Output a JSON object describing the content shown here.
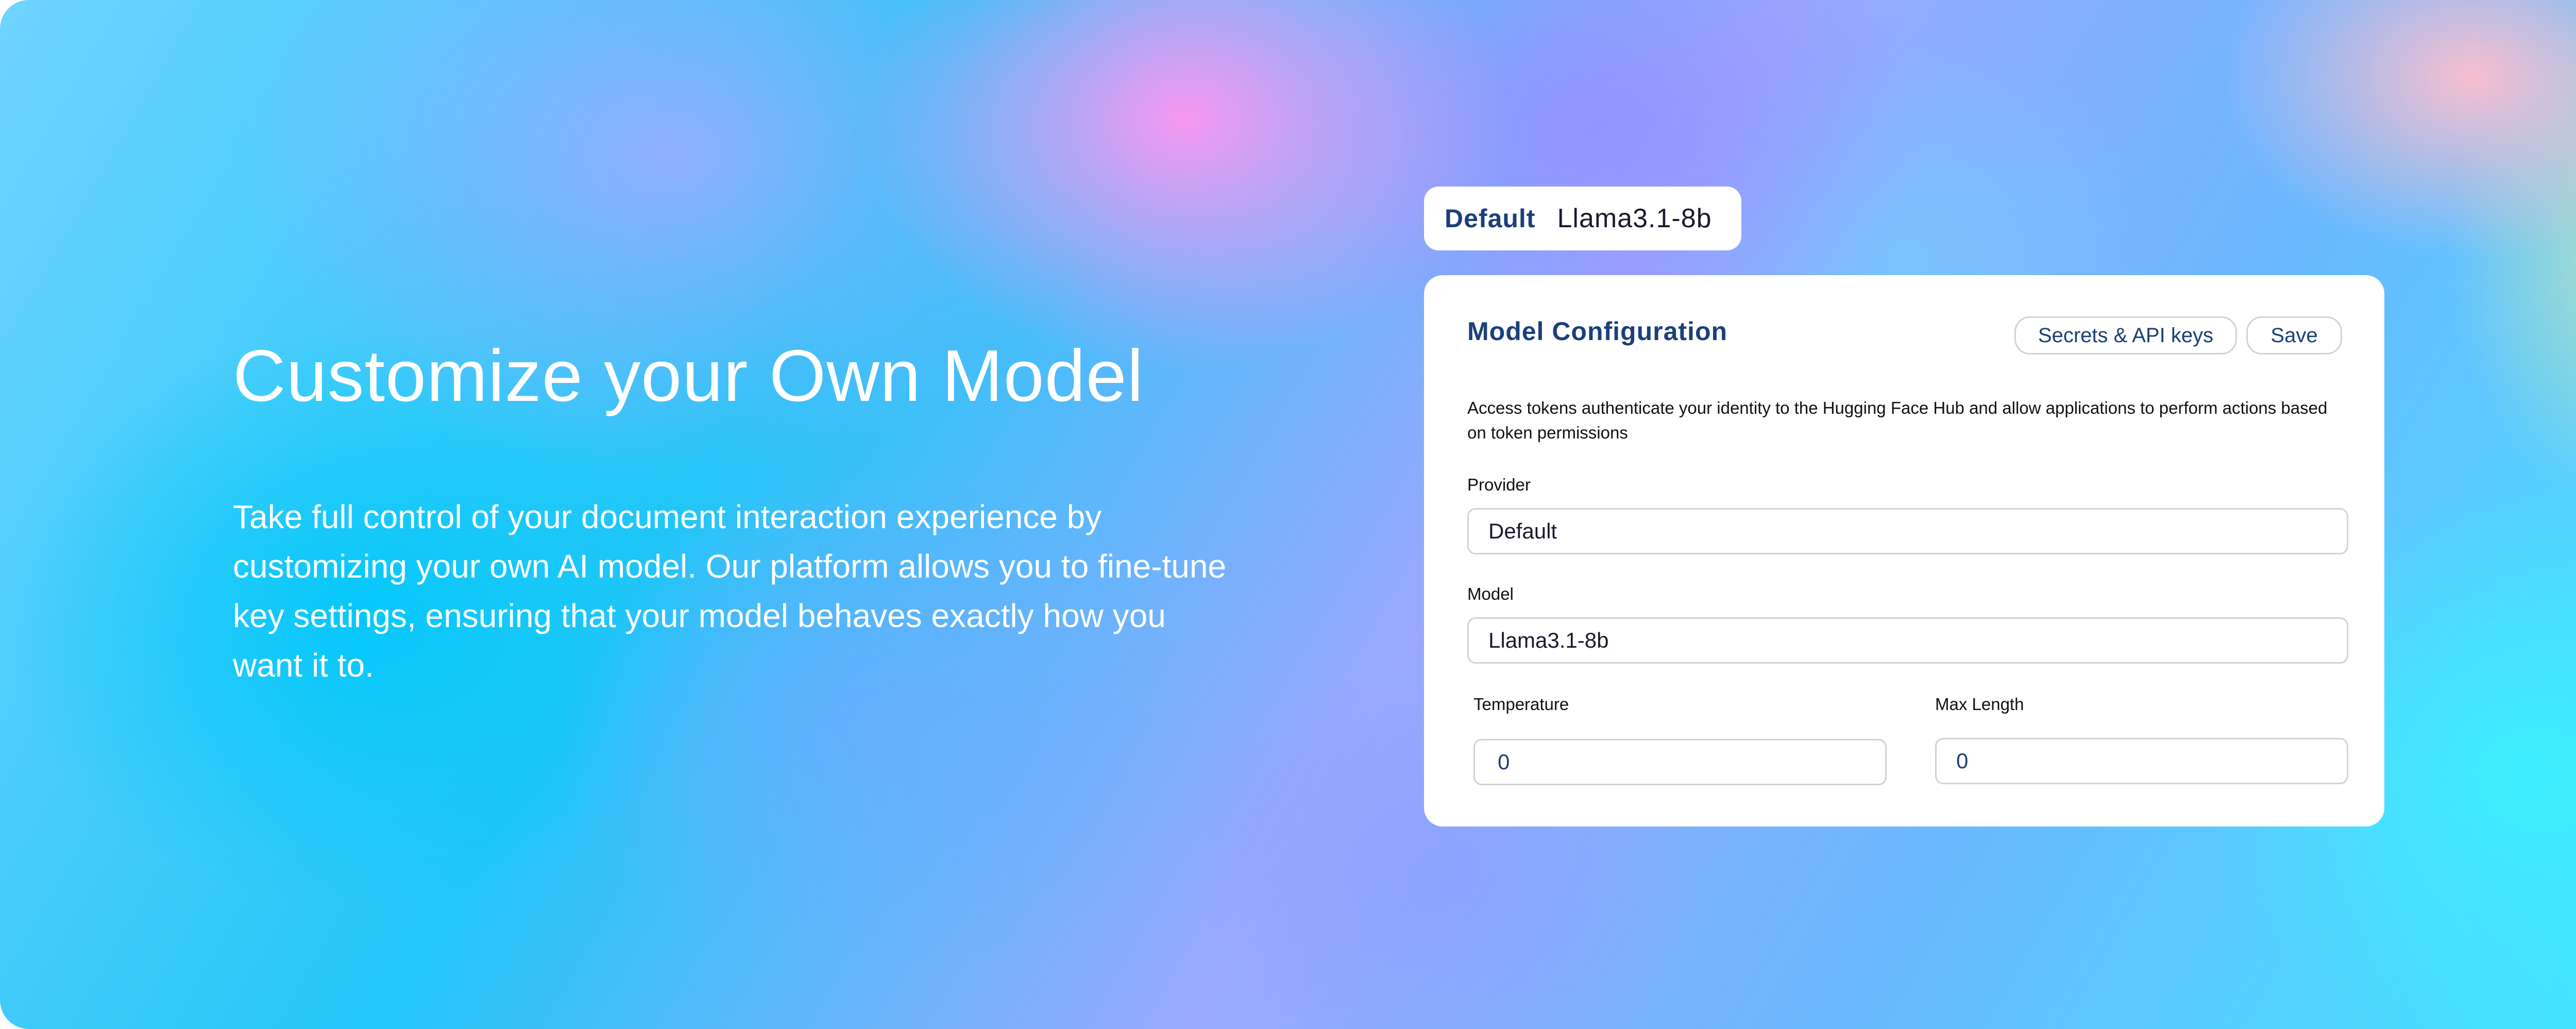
{
  "hero": {
    "headline": "Customize your Own Model",
    "description": "Take full control of your document interaction experience by customizing your own AI model. Our platform allows you to fine-tune key settings, ensuring that your model behaves exactly how you want it to."
  },
  "model_pill": {
    "label": "Default",
    "value": "Llama3.1-8b"
  },
  "config": {
    "title": "Model Configuration",
    "secrets_button": "Secrets & API keys",
    "save_button": "Save",
    "description": "Access tokens authenticate your identity to the Hugging Face Hub and allow applications to perform actions based on token permissions",
    "provider_label": "Provider",
    "provider_value": "Default",
    "model_label": "Model",
    "model_value": "Llama3.1-8b",
    "temperature_label": "Temperature",
    "temperature_value": "0",
    "max_length_label": "Max Length",
    "max_length_value": "0"
  },
  "colors": {
    "accent": "#1b3f7a",
    "border": "#cfd3da"
  }
}
